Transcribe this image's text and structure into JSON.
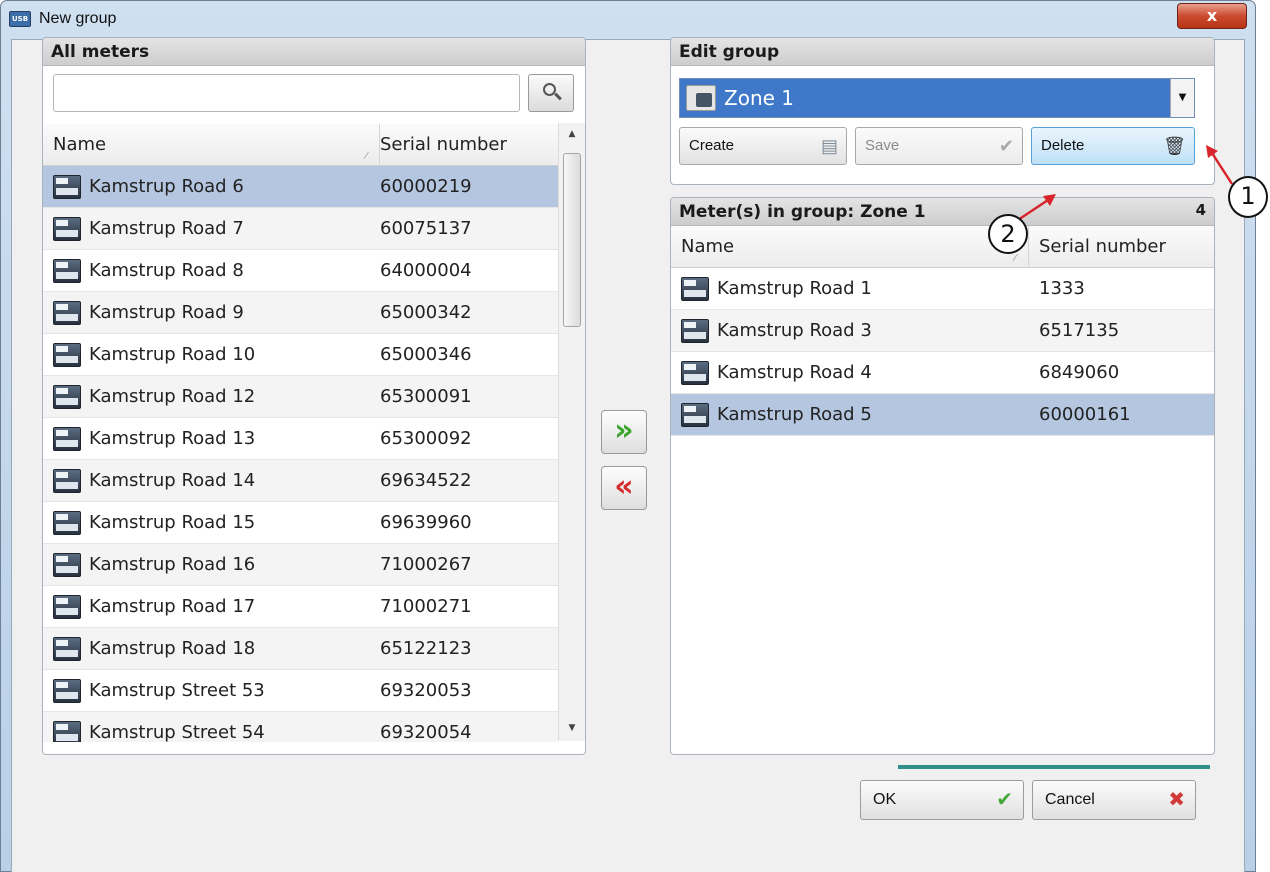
{
  "window": {
    "title": "New group",
    "icon_label": "USB",
    "close_label": "x"
  },
  "all_meters": {
    "header": "All meters",
    "search": {
      "value": "",
      "placeholder": ""
    },
    "columns": {
      "name": "Name",
      "serial": "Serial number"
    },
    "rows": [
      {
        "name": "Kamstrup Road 6",
        "serial": "60000219",
        "selected": true
      },
      {
        "name": "Kamstrup Road 7",
        "serial": "60075137"
      },
      {
        "name": "Kamstrup Road 8",
        "serial": "64000004"
      },
      {
        "name": "Kamstrup Road 9",
        "serial": "65000342"
      },
      {
        "name": "Kamstrup Road 10",
        "serial": "65000346"
      },
      {
        "name": "Kamstrup Road 12",
        "serial": "65300091"
      },
      {
        "name": "Kamstrup Road 13",
        "serial": "65300092"
      },
      {
        "name": "Kamstrup Road 14",
        "serial": "69634522"
      },
      {
        "name": "Kamstrup Road 15",
        "serial": "69639960"
      },
      {
        "name": "Kamstrup Road 16",
        "serial": "71000267"
      },
      {
        "name": "Kamstrup Road 17",
        "serial": "71000271"
      },
      {
        "name": "Kamstrup Road 18",
        "serial": "65122123"
      },
      {
        "name": "Kamstrup Street 53",
        "serial": "69320053"
      },
      {
        "name": "Kamstrup Street 54",
        "serial": "69320054"
      }
    ]
  },
  "move": {
    "add_glyph": "»",
    "remove_glyph": "«"
  },
  "edit_group": {
    "header": "Edit group",
    "selected_group": "Zone 1",
    "buttons": {
      "create": "Create",
      "save": "Save",
      "delete": "Delete"
    }
  },
  "group_meters": {
    "header": "Meter(s) in group: Zone 1",
    "count": "4",
    "columns": {
      "name": "Name",
      "serial": "Serial number"
    },
    "rows": [
      {
        "name": "Kamstrup Road 1",
        "serial": "1333"
      },
      {
        "name": "Kamstrup Road 3",
        "serial": "6517135"
      },
      {
        "name": "Kamstrup Road 4",
        "serial": "6849060"
      },
      {
        "name": "Kamstrup Road 5",
        "serial": "60000161",
        "selected": true
      }
    ]
  },
  "footer": {
    "ok": "OK",
    "cancel": "Cancel"
  },
  "callouts": [
    "1",
    "2"
  ],
  "icons": {
    "window": "usb-icon",
    "search": "search-icon",
    "meter": "meter-icon",
    "group": "group-icon",
    "create": "create-group-icon",
    "save": "checkmark-icon",
    "delete": "trash-icon",
    "ok": "checkmark-icon",
    "cancel": "cross-icon"
  },
  "colors": {
    "selection": "#b4c6e0",
    "combo_bg": "#3f78c9",
    "ok_check": "#45a83a",
    "cancel_cross": "#d23a3a",
    "arrow_callout": "#d9242b"
  }
}
